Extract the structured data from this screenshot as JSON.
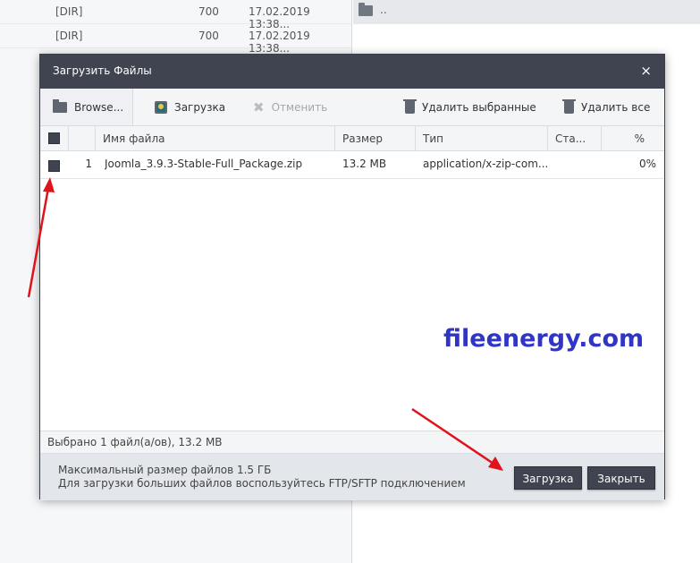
{
  "background": {
    "rows": [
      {
        "type": "[DIR]",
        "perms": "700",
        "date": "17.02.2019 13:38..."
      },
      {
        "type": "[DIR]",
        "perms": "700",
        "date": "17.02.2019 13:38..."
      }
    ],
    "right_item": ".."
  },
  "dialog": {
    "title": "Загрузить Файлы",
    "close_glyph": "×",
    "toolbar": {
      "browse": "Browse...",
      "upload": "Загрузка",
      "cancel": "Отменить",
      "delete_selected": "Удалить выбранные",
      "delete_all": "Удалить все"
    },
    "columns": {
      "name": "Имя файла",
      "size": "Размер",
      "type": "Тип",
      "status": "Ста...",
      "percent": "%"
    },
    "files": [
      {
        "num": "1",
        "name": "Joomla_3.9.3-Stable-Full_Package.zip",
        "size": "13.2 MB",
        "type": "application/x-zip-com...",
        "status": "",
        "percent": "0%"
      }
    ],
    "status": "Выбрано 1 файл(а/ов), 13.2 MB",
    "footer": {
      "line1": "Максимальный размер файлов 1.5 ГБ",
      "line2": "Для загрузки больших файлов воспользуйтесь FTP/SFTP подключением",
      "upload_button": "Загрузка",
      "close_button": "Закрыть"
    }
  },
  "watermark": "fileenergy.com",
  "colors": {
    "header_bg": "#3f4450",
    "annotation_arrow": "#e0121b",
    "watermark": "#2f35c7"
  }
}
